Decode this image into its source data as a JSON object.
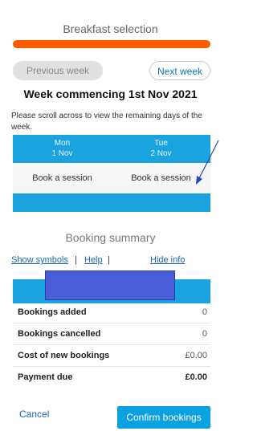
{
  "header": {
    "title": "Breakfast selection"
  },
  "week_nav": {
    "previous_label": "Previous week",
    "next_label": "Next week",
    "heading": "Week commencing 1st Nov 2021",
    "scroll_note": "Please scroll across to view the remaining days of the week."
  },
  "days": [
    {
      "day": "Mon",
      "date": "1 Nov",
      "action": "Book a session"
    },
    {
      "day": "Tue",
      "date": "2 Nov",
      "action": "Book a session"
    }
  ],
  "summary": {
    "title": "Booking summary",
    "links": {
      "show_symbols": "Show symbols",
      "separator": "|",
      "help": "Help",
      "hide_info": "Hide info"
    },
    "rows": [
      {
        "label": "Bookings added",
        "value": "0"
      },
      {
        "label": "Bookings cancelled",
        "value": "0"
      },
      {
        "label": "Cost of new bookings",
        "value": "£0.00"
      },
      {
        "label": "Payment due",
        "value": "£0.00"
      }
    ]
  },
  "footer": {
    "cancel_label": "Cancel",
    "confirm_label": "Confirm bookings"
  },
  "colors": {
    "accent_orange": "#ff5a00",
    "grid_blue": "#1aa3de",
    "button_blue": "#0aa0e2",
    "link_blue": "#1a66c2",
    "redaction": "#4a5dd6"
  }
}
